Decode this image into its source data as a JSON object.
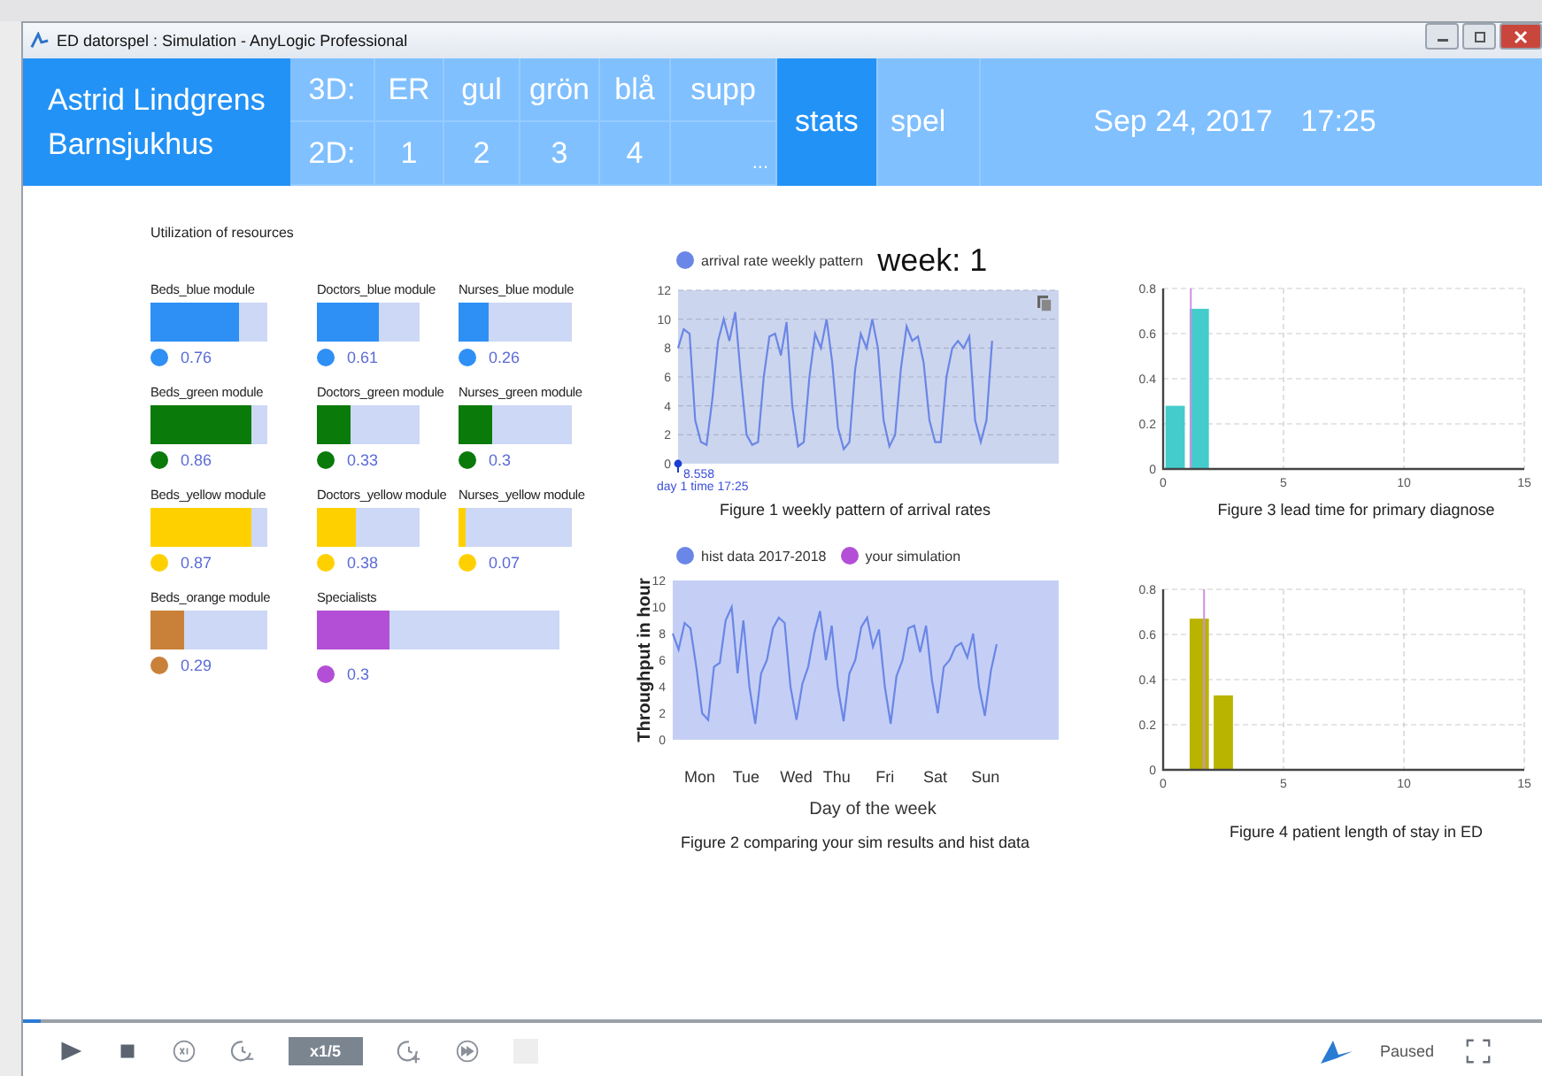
{
  "window": {
    "title": "ED datorspel : Simulation - AnyLogic Professional"
  },
  "header": {
    "title_lines": [
      "Astrid Lindgrens",
      "Barnsjukhus"
    ],
    "nav_rows": [
      {
        "label": "3D:",
        "items": [
          "ER",
          "gul",
          "grön",
          "blå",
          "supp"
        ]
      },
      {
        "label": "2D:",
        "items": [
          "1",
          "2",
          "3",
          "4",
          "..."
        ]
      }
    ],
    "tabs": [
      {
        "label": "stats",
        "selected": true
      },
      {
        "label": "spel",
        "selected": false
      }
    ],
    "date": "Sep 24, 2017",
    "time": "17:25"
  },
  "resources": {
    "title": "Utilization of resources",
    "items": [
      {
        "label": "Beds_blue module",
        "level": 0.76,
        "reading": "0.76",
        "color": "#2e8ff5",
        "kind": "normal"
      },
      {
        "label": "Doctors_blue module",
        "level": 0.61,
        "reading": "0.61",
        "color": "#2e8ff5",
        "kind": "normal"
      },
      {
        "label": "Nurses_blue module",
        "level": 0.26,
        "reading": "0.26",
        "color": "#2e8ff5",
        "kind": "normal"
      },
      {
        "label": "Beds_green module",
        "level": 0.86,
        "reading": "0.86",
        "color": "#0a7a0a",
        "kind": "normal"
      },
      {
        "label": "Doctors_green module",
        "level": 0.33,
        "reading": "0.33",
        "color": "#0a7a0a",
        "kind": "normal"
      },
      {
        "label": "Nurses_green module",
        "level": 0.3,
        "reading": "0.3",
        "color": "#0a7a0a",
        "kind": "normal"
      },
      {
        "label": "Beds_yellow module",
        "level": 0.87,
        "reading": "0.87",
        "color": "#ffd000",
        "kind": "normal"
      },
      {
        "label": "Doctors_yellow module",
        "level": 0.38,
        "reading": "0.38",
        "color": "#ffd000",
        "kind": "normal"
      },
      {
        "label": "Nurses_yellow module",
        "level": 0.07,
        "reading": "0.07",
        "color": "#ffd000",
        "kind": "normal"
      },
      {
        "label": "Beds_orange module",
        "level": 0.29,
        "reading": "0.29",
        "color": "#c9813a",
        "kind": "normal"
      },
      {
        "label": "Specialists",
        "level": 0.3,
        "reading": "0.3",
        "color": "#b34fd6",
        "kind": "wide"
      }
    ]
  },
  "figure1": {
    "week": "week: 1",
    "marker_value": "8.558",
    "marker_time": "day 1 time 17:25",
    "caption": "Figure 1 weekly pattern of arrival rates",
    "chart_data": {
      "type": "line",
      "ylim": [
        0,
        12
      ],
      "yticks": [
        0,
        2,
        4,
        6,
        8,
        10,
        12
      ],
      "grid": true,
      "series": [
        {
          "name": "arrival rate weekly pattern",
          "color": "#6a86e6",
          "values": [
            8,
            9.3,
            9,
            3,
            1.5,
            1.3,
            4.5,
            8.5,
            10,
            8.5,
            10.5,
            6,
            2,
            1.3,
            1.5,
            6,
            8.8,
            9,
            7.5,
            9.8,
            4,
            1.2,
            1.5,
            6,
            9,
            8,
            10,
            7,
            2.5,
            1,
            1.5,
            6.5,
            9,
            8,
            10,
            8,
            3,
            1.2,
            2,
            6.5,
            9.5,
            8.5,
            8.8,
            7,
            3,
            1.5,
            1.5,
            6,
            8,
            8.5,
            8,
            8.8,
            3,
            1.5,
            3,
            8.5
          ]
        }
      ]
    }
  },
  "figure2": {
    "caption": "Figure 2 comparing your sim results and hist data",
    "day_labels": [
      "Mon",
      "Tue",
      "Wed",
      "Thu",
      "Fri",
      "Sat",
      "Sun"
    ],
    "chart_data": {
      "type": "line",
      "xlabel": "Day of the week",
      "ylabel": "Throughput in hour",
      "ylim": [
        0,
        12
      ],
      "yticks": [
        0,
        2,
        4,
        6,
        8,
        10,
        12
      ],
      "series": [
        {
          "name": "hist data 2017-2018",
          "color": "#6a86e6",
          "values": [
            8,
            6.8,
            8.8,
            8.4,
            5.5,
            2,
            1.5,
            5.5,
            5.8,
            9,
            10,
            5,
            9,
            4,
            1.2,
            5,
            6,
            8.4,
            9.2,
            8.8,
            4,
            1.5,
            4.2,
            5.5,
            8,
            9.7,
            6,
            8.6,
            4,
            1.4,
            5,
            6,
            8.5,
            9.2,
            7,
            8.3,
            4,
            1.2,
            4.8,
            6,
            8.4,
            8.6,
            6.6,
            8.6,
            4.5,
            2,
            5.5,
            6,
            7,
            7.3,
            6.2,
            8,
            4,
            1.8,
            5.2,
            7.2
          ]
        },
        {
          "name": "your simulation",
          "color": "#b34fd6"
        }
      ]
    }
  },
  "figure3": {
    "caption": "Figure 3 lead time for primary diagnose",
    "chart_data": {
      "type": "bar",
      "x": [
        0.5,
        1.5
      ],
      "xlim": [
        0,
        15
      ],
      "ylim": [
        0,
        0.8
      ],
      "xticks": [
        0,
        5,
        10,
        15
      ],
      "yticks": [
        0,
        0.2,
        0.4,
        0.6,
        0.8
      ],
      "grid": true,
      "series": [
        {
          "color": "#44cccc",
          "values": [
            0.28,
            0.71
          ]
        }
      ],
      "ref_lines": [
        {
          "axis": "x",
          "value": 1.15,
          "color": "#d08ee0"
        }
      ]
    }
  },
  "figure4": {
    "caption": "Figure 4 patient length of stay in ED",
    "chart_data": {
      "type": "bar",
      "x": [
        1.5,
        2.5
      ],
      "xlim": [
        0,
        15
      ],
      "ylim": [
        0,
        0.8
      ],
      "xticks": [
        0,
        5,
        10,
        15
      ],
      "yticks": [
        0,
        0.2,
        0.4,
        0.6,
        0.8
      ],
      "grid": true,
      "series": [
        {
          "color": "#b8b400",
          "values": [
            0.67,
            0.33
          ]
        }
      ],
      "ref_lines": [
        {
          "axis": "x",
          "value": 1.7,
          "color": "#d08ee0"
        }
      ]
    }
  },
  "toolbar": {
    "progress": {
      "level": 0.012
    },
    "speed": "x1/5",
    "status": "Paused"
  }
}
